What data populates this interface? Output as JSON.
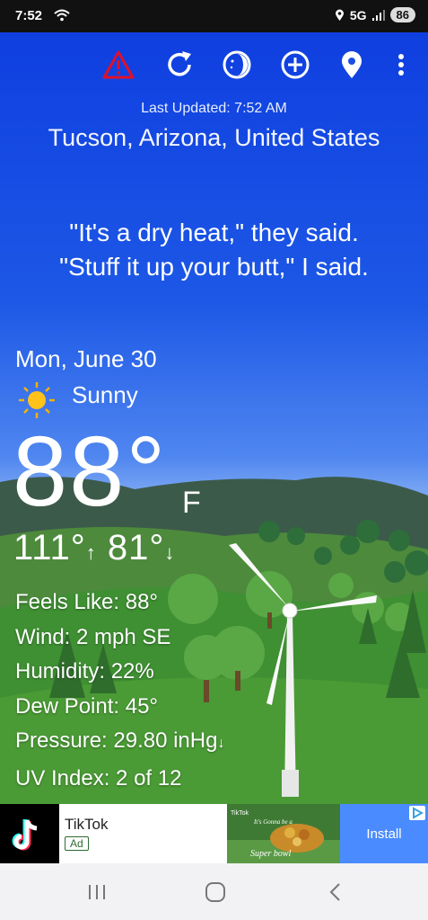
{
  "status": {
    "time": "7:52",
    "network": "5G",
    "battery": "86"
  },
  "toolbar": {
    "icons": [
      "alert-triangle-icon",
      "refresh-icon",
      "moon-phase-icon",
      "add-location-icon",
      "map-pin-icon",
      "more-vert-icon"
    ]
  },
  "weather": {
    "updated": "Last Updated: 7:52 AM",
    "location": "Tucson, Arizona, United States",
    "quote_line1": "\"It's a dry heat,\" they said.",
    "quote_line2": "\"Stuff it up your butt,\" I said.",
    "date": "Mon, June 30",
    "condition": "Sunny",
    "temperature": "88°",
    "unit": "F",
    "high": "111°",
    "low": "81°",
    "feels_like": "Feels Like:  88°",
    "wind": "Wind:  2 mph SE",
    "humidity": "Humidity:  22%",
    "dew_point": "Dew Point:  45°",
    "pressure": "Pressure:  29.80 inHg",
    "uv": "UV Index:  2 of 12"
  },
  "ad": {
    "app_name": "TikTok",
    "badge": "Ad",
    "cta": "Install",
    "creative_brand": "TikTok",
    "creative_text1": "It's Gonna be a",
    "creative_text2": "Super bowl"
  },
  "colors": {
    "sky_top": "#0f3fe0",
    "grass": "#3f8f33",
    "alert": "#e0102a",
    "install_bg": "#4a8cff"
  }
}
